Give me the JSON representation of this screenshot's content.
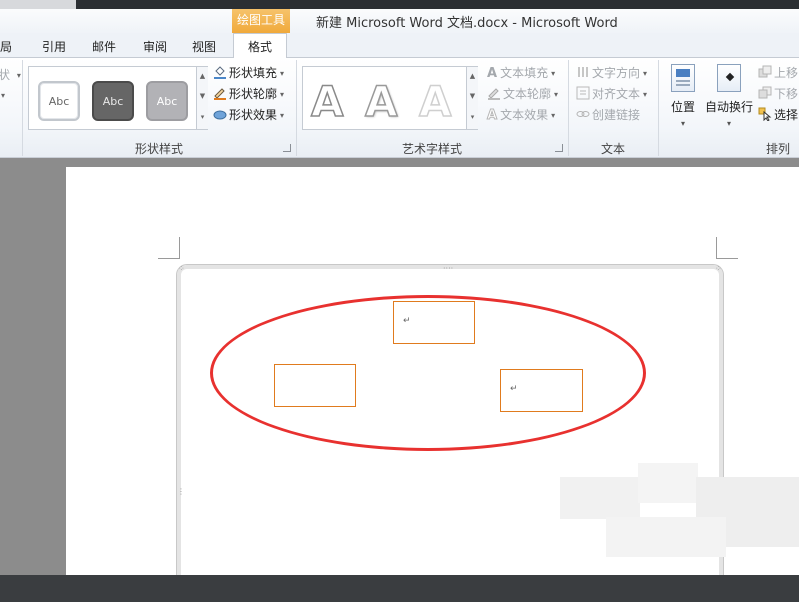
{
  "window": {
    "title": "新建 Microsoft Word 文档.docx  -  Microsoft Word",
    "context_tab_header": "绘图工具"
  },
  "tabs": [
    {
      "label": "布局"
    },
    {
      "label": "引用"
    },
    {
      "label": "邮件"
    },
    {
      "label": "审阅"
    },
    {
      "label": "视图"
    },
    {
      "label": "格式",
      "active": true
    }
  ],
  "ribbon": {
    "shape_styles": {
      "tiles": [
        "Abc",
        "Abc",
        "Abc"
      ],
      "fill": "形状填充",
      "outline": "形状轮廓",
      "effects": "形状效果",
      "label": "形状样式"
    },
    "wordart_styles": {
      "glyph": "A",
      "text_fill": "文本填充",
      "text_outline": "文本轮廓",
      "text_effects": "文本效果",
      "label": "艺术字样式"
    },
    "text": {
      "direction": "文字方向",
      "align": "对齐文本",
      "create_link": "创建链接",
      "label": "文本"
    },
    "arrange": {
      "position": "位置",
      "wrap": "自动换行",
      "bring_forward": "上移",
      "send_backward": "下移",
      "selection": "选择",
      "label": "排列"
    }
  },
  "document": {
    "paragraph_mark": "↵"
  },
  "colors": {
    "accent_orange": "#f0a93b",
    "textbox_border": "#e07b1e",
    "annotation_red": "#e8312f"
  }
}
